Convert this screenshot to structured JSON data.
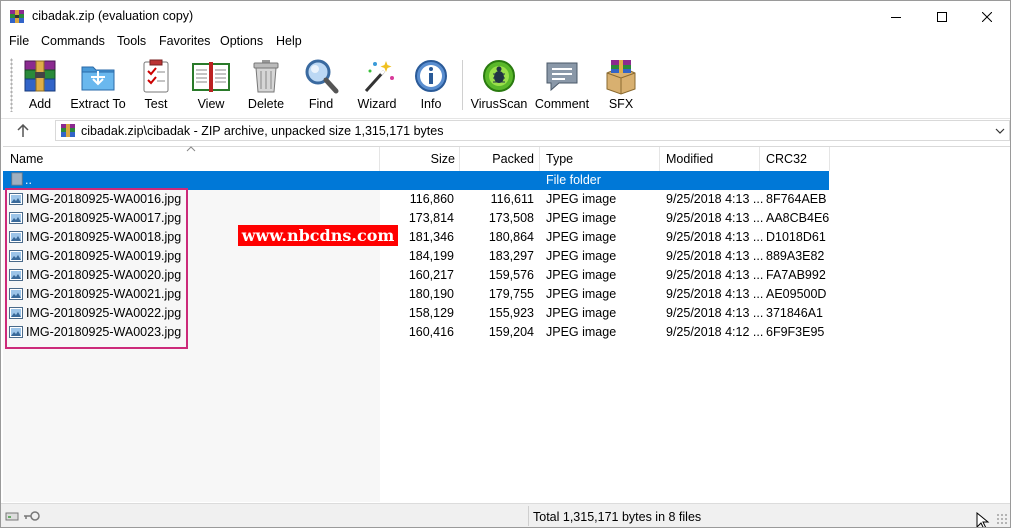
{
  "window": {
    "title": "cibadak.zip (evaluation copy)",
    "controls": [
      "minimize",
      "maximize",
      "close"
    ]
  },
  "menu": [
    "File",
    "Commands",
    "Tools",
    "Favorites",
    "Options",
    "Help"
  ],
  "toolbar": {
    "add": "Add",
    "extract_to": "Extract To",
    "test": "Test",
    "view": "View",
    "delete": "Delete",
    "find": "Find",
    "wizard": "Wizard",
    "info": "Info",
    "virusscan": "VirusScan",
    "comment": "Comment",
    "sfx": "SFX"
  },
  "address": {
    "path": "cibadak.zip\\cibadak - ZIP archive, unpacked size 1,315,171 bytes"
  },
  "columns": {
    "name": "Name",
    "size": "Size",
    "packed": "Packed",
    "type": "Type",
    "modified": "Modified",
    "crc32": "CRC32"
  },
  "parent_row": {
    "name": "..",
    "type": "File folder"
  },
  "files": [
    {
      "name": "IMG-20180925-WA0016.jpg",
      "size": "116,860",
      "packed": "116,611",
      "type": "JPEG image",
      "modified": "9/25/2018 4:13 ...",
      "crc32": "8F764AEB"
    },
    {
      "name": "IMG-20180925-WA0017.jpg",
      "size": "173,814",
      "packed": "173,508",
      "type": "JPEG image",
      "modified": "9/25/2018 4:13 ...",
      "crc32": "AA8CB4E6"
    },
    {
      "name": "IMG-20180925-WA0018.jpg",
      "size": "181,346",
      "packed": "180,864",
      "type": "JPEG image",
      "modified": "9/25/2018 4:13 ...",
      "crc32": "D1018D61"
    },
    {
      "name": "IMG-20180925-WA0019.jpg",
      "size": "184,199",
      "packed": "183,297",
      "type": "JPEG image",
      "modified": "9/25/2018 4:13 ...",
      "crc32": "889A3E82"
    },
    {
      "name": "IMG-20180925-WA0020.jpg",
      "size": "160,217",
      "packed": "159,576",
      "type": "JPEG image",
      "modified": "9/25/2018 4:13 ...",
      "crc32": "FA7AB992"
    },
    {
      "name": "IMG-20180925-WA0021.jpg",
      "size": "180,190",
      "packed": "179,755",
      "type": "JPEG image",
      "modified": "9/25/2018 4:13 ...",
      "crc32": "AE09500D"
    },
    {
      "name": "IMG-20180925-WA0022.jpg",
      "size": "158,129",
      "packed": "155,923",
      "type": "JPEG image",
      "modified": "9/25/2018 4:13 ...",
      "crc32": "371846A1"
    },
    {
      "name": "IMG-20180925-WA0023.jpg",
      "size": "160,416",
      "packed": "159,204",
      "type": "JPEG image",
      "modified": "9/25/2018 4:12 ...",
      "crc32": "6F9F3E95"
    }
  ],
  "watermark": "www.nbcdns.com",
  "status": {
    "text": "Total 1,315,171 bytes in 8 files"
  },
  "colors": {
    "selection": "#0078d7",
    "highlight_box": "#cc2a7a",
    "watermark_bg": "#ff0000"
  }
}
